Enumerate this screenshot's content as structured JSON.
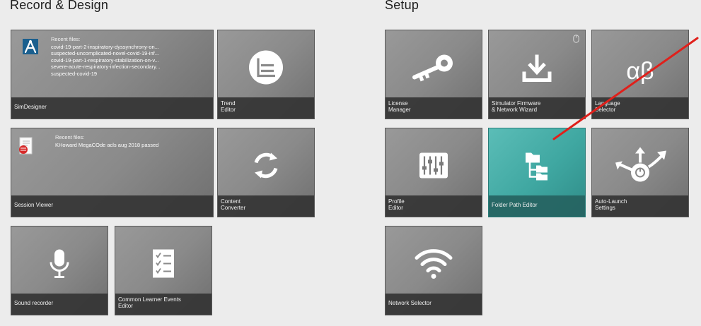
{
  "sections": {
    "record_design": "Record & Design",
    "setup": "Setup"
  },
  "simdesigner": {
    "label": "SimDesigner",
    "recent_heading": "Recent files:",
    "recent_files": [
      "covid-19-part-2-inspiratory-dyssynchrony-on...",
      "suspected-uncomplicated-novel-covid-19-inf...",
      "covid-19-part-1-respiratory-stabilization-on-v...",
      "severe-acute-respiratory-infection-secondary...",
      "suspected-covid-19"
    ]
  },
  "trend_editor": {
    "line1": "Trend",
    "line2": "Editor"
  },
  "session_viewer": {
    "label": "Session Viewer",
    "recent_heading": "Recent files:",
    "recent_files": [
      "KHoward MegaCOde acls aug 2018 passed"
    ]
  },
  "content_converter": {
    "line1": "Content",
    "line2": "Converter"
  },
  "sound_recorder": {
    "label": "Sound recorder"
  },
  "common_learner_events": {
    "line1": "Common Learner Events",
    "line2": "Editor"
  },
  "license_manager": {
    "line1": "License",
    "line2": "Manager"
  },
  "simulator_firmware": {
    "line1": "Simulator Firmware",
    "line2": "& Network Wizard"
  },
  "language_selector": {
    "line1": "Language",
    "line2": "Selector",
    "glyph": "αβ"
  },
  "profile_editor": {
    "line1": "Profile",
    "line2": "Editor"
  },
  "folder_path_editor": {
    "label": "Folder Path Editor"
  },
  "auto_launch": {
    "line1": "Auto-Launch",
    "line2": "Settings"
  },
  "network_selector": {
    "label": "Network Selector"
  },
  "colors": {
    "tile": "#8a8a8a",
    "active_tile": "#3fa7a1",
    "label_bar": "#343434",
    "annotation_arrow": "#e0201b"
  }
}
